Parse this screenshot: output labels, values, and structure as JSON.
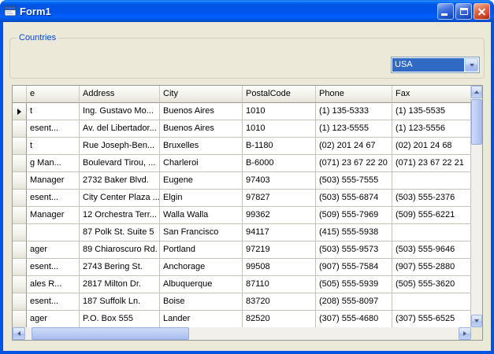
{
  "window": {
    "title": "Form1"
  },
  "colors": {
    "titlebar_blue": "#0054e3",
    "client_background": "#ece9d8",
    "selection_blue": "#316ac5",
    "groupbox_label_blue": "#0046d5",
    "close_button_red": "#d0482a",
    "grid_line_gray": "#c5c2ba"
  },
  "icons": {
    "titlebar": "form-window-icon",
    "minimize": "minimize-icon",
    "maximize": "maximize-icon",
    "close": "close-icon",
    "combo_dropdown": "chevron-down-icon",
    "scroll_up": "arrow-up-icon",
    "scroll_down": "arrow-down-icon",
    "scroll_left": "arrow-left-icon",
    "scroll_right": "arrow-right-icon",
    "current_row": "current-row-arrow-icon"
  },
  "countries_group": {
    "label": "Countries",
    "combo": {
      "value": "USA"
    }
  },
  "grid": {
    "columns": [
      "e",
      "Address",
      "City",
      "PostalCode",
      "Phone",
      "Fax"
    ],
    "current_row_index": 0,
    "rows": [
      [
        "t",
        "Ing. Gustavo Mo...",
        "Buenos Aires",
        "1010",
        "(1) 135-5333",
        "(1) 135-5535"
      ],
      [
        "esent...",
        "Av. del Libertador...",
        "Buenos Aires",
        "1010",
        "(1) 123-5555",
        "(1) 123-5556"
      ],
      [
        "t",
        "Rue Joseph-Ben...",
        "Bruxelles",
        "B-1180",
        "(02) 201 24 67",
        "(02) 201 24 68"
      ],
      [
        "g Man...",
        "Boulevard Tirou, ...",
        "Charleroi",
        "B-6000",
        "(071) 23 67 22 20",
        "(071) 23 67 22 21"
      ],
      [
        "Manager",
        "2732 Baker Blvd.",
        "Eugene",
        "97403",
        "(503) 555-7555",
        ""
      ],
      [
        "esent...",
        "City Center Plaza ...",
        "Elgin",
        "97827",
        "(503) 555-6874",
        "(503) 555-2376"
      ],
      [
        "Manager",
        "12 Orchestra Terr...",
        "Walla Walla",
        "99362",
        "(509) 555-7969",
        "(509) 555-6221"
      ],
      [
        "",
        "87 Polk St. Suite 5",
        "San Francisco",
        "94117",
        "(415) 555-5938",
        ""
      ],
      [
        "ager",
        "89 Chiaroscuro Rd.",
        "Portland",
        "97219",
        "(503) 555-9573",
        "(503) 555-9646"
      ],
      [
        "esent...",
        "2743 Bering St.",
        "Anchorage",
        "99508",
        "(907) 555-7584",
        "(907) 555-2880"
      ],
      [
        "ales R...",
        "2817 Milton Dr.",
        "Albuquerque",
        "87110",
        "(505) 555-5939",
        "(505) 555-3620"
      ],
      [
        "esent...",
        "187 Suffolk Ln.",
        "Boise",
        "83720",
        "(208) 555-8097",
        ""
      ],
      [
        "ager",
        "P.O. Box 555",
        "Lander",
        "82520",
        "(307) 555-4680",
        "(307) 555-6525"
      ]
    ]
  }
}
